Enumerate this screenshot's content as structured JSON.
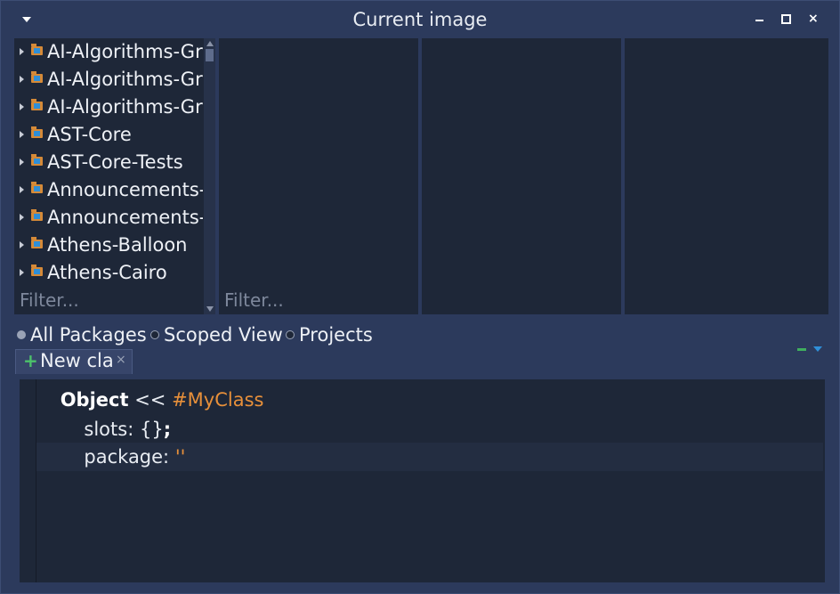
{
  "window": {
    "title": "Current image"
  },
  "packages": {
    "items": [
      {
        "label": "AI-Algorithms-Gra"
      },
      {
        "label": "AI-Algorithms-Gra"
      },
      {
        "label": "AI-Algorithms-Gra"
      },
      {
        "label": "AST-Core"
      },
      {
        "label": "AST-Core-Tests"
      },
      {
        "label": "Announcements-("
      },
      {
        "label": "Announcements-("
      },
      {
        "label": "Athens-Balloon"
      },
      {
        "label": "Athens-Cairo"
      }
    ],
    "filter_placeholder": "Filter..."
  },
  "classes": {
    "filter_placeholder": "Filter..."
  },
  "scope": {
    "options": [
      {
        "label": "All Packages",
        "selected": true
      },
      {
        "label": "Scoped View",
        "selected": false
      },
      {
        "label": "Projects",
        "selected": false
      }
    ]
  },
  "tabs": [
    {
      "label": "New cla",
      "close": "×"
    }
  ],
  "editor": {
    "line1": {
      "class_name": "Object",
      "op": " << ",
      "symbol": "#MyClass"
    },
    "line2": {
      "keyword": "slots:",
      "value": " {}",
      "semi": ";"
    },
    "line3": {
      "keyword": "package:",
      "value": " ''"
    }
  },
  "colors": {
    "background": "#1e2738",
    "chrome": "#2c3a5c",
    "symbol": "#e8903a",
    "add_tab": "#4cc26a"
  }
}
